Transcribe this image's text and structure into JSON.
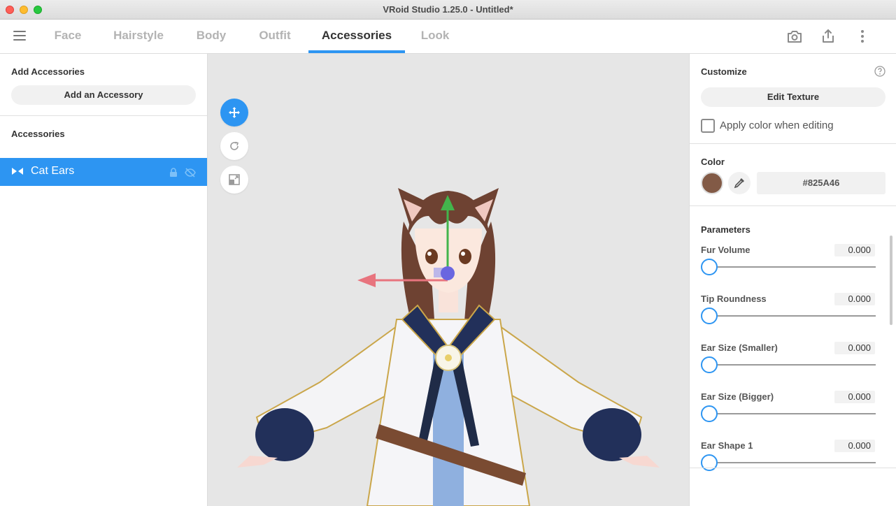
{
  "window": {
    "title": "VRoid Studio 1.25.0 - Untitled*"
  },
  "nav": {
    "tabs": [
      "Face",
      "Hairstyle",
      "Body",
      "Outfit",
      "Accessories",
      "Look"
    ],
    "active_tab": "Accessories",
    "icons": [
      "camera-icon",
      "export-icon",
      "more-vertical-icon"
    ]
  },
  "left": {
    "add_section_title": "Add Accessories",
    "add_button": "Add an Accessory",
    "list_title": "Accessories",
    "items": [
      {
        "label": "Cat Ears",
        "selected": true
      }
    ]
  },
  "viewport": {
    "tools": [
      "move-tool",
      "rotate-tool",
      "scale-tool"
    ],
    "active_tool": "move-tool"
  },
  "right": {
    "customize_title": "Customize",
    "edit_texture_button": "Edit Texture",
    "apply_color_label": "Apply color when editing",
    "apply_color_checked": false,
    "color_title": "Color",
    "color_value": "#825A46",
    "parameters_title": "Parameters",
    "parameters": [
      {
        "label": "Fur Volume",
        "value": "0.000",
        "level": 0
      },
      {
        "label": "Tip Roundness",
        "value": "0.000",
        "level": 0
      },
      {
        "label": "Ear Size (Smaller)",
        "value": "0.000",
        "level": 0
      },
      {
        "label": "Ear Size (Bigger)",
        "value": "0.000",
        "level": 0
      },
      {
        "label": "Ear Shape 1",
        "value": "0.000",
        "level": 0
      }
    ]
  },
  "colors": {
    "accent": "#2D95F2",
    "swatch": "#825A46"
  }
}
